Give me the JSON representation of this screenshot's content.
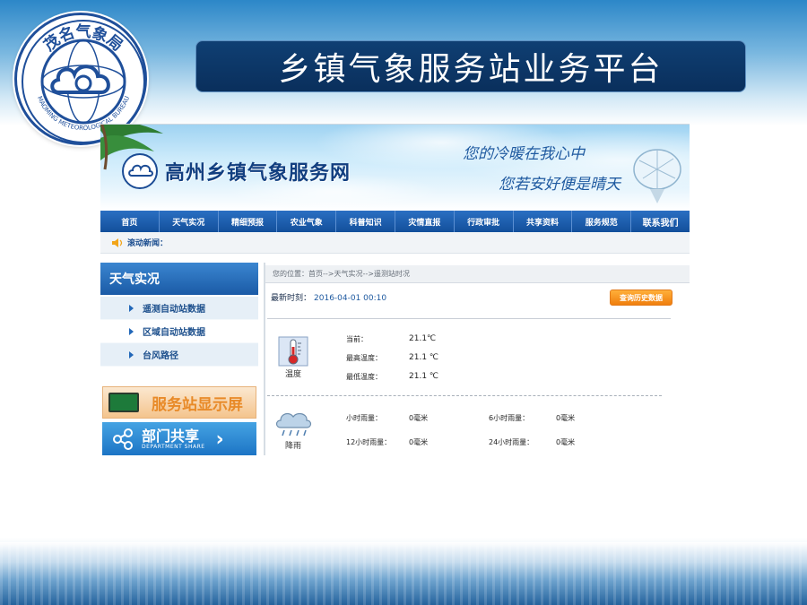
{
  "slide": {
    "title": "乡镇气象服务站业务平台",
    "emblem_text": "茂名气象局",
    "emblem_ring_text": "MAOMING METEOROLOGICAL BUREAU"
  },
  "site": {
    "title": "高州乡镇气象服务网",
    "slogan_line1": "您的冷暖在我心中",
    "slogan_line2": "您若安好便是晴天",
    "nav": [
      "首页",
      "天气实况",
      "精细预报",
      "农业气象",
      "科普知识",
      "灾情直报",
      "行政审批",
      "共享资料",
      "服务规范",
      "联系我们"
    ],
    "ticker_label": "滚动新闻：",
    "sidebar": {
      "heading": "天气实况",
      "items": [
        "遥测自动站数据",
        "区域自动站数据",
        "台风路径"
      ],
      "banner_screen": "服务站显示屏",
      "banner_share": "部门共享",
      "banner_share_en": "DEPARTMENT SHARE"
    },
    "breadcrumb": "您的位置：首页-->天气实况-->遥测站时况",
    "latest_time_label": "最新时刻：",
    "latest_time_value": "2016-04-01 00:10",
    "history_button": "查询历史数据",
    "temperature": {
      "label": "温度",
      "current_label": "当前：",
      "current_value": "21.1℃",
      "max_label": "最高温度：",
      "max_value": "21.1 ℃",
      "min_label": "最低温度：",
      "min_value": "21.1 ℃"
    },
    "rain": {
      "label": "降雨",
      "hour_label": "小时雨量：",
      "hour_value": "0毫米",
      "h6_label": "6小时雨量：",
      "h6_value": "0毫米",
      "h12_label": "12小时雨量：",
      "h12_value": "0毫米",
      "h24_label": "24小时雨量：",
      "h24_value": "0毫米"
    }
  },
  "colors": {
    "banner_bg": "#0f3f73",
    "nav_bg": "#1a5aa6",
    "history_btn": "#f58a1a"
  }
}
